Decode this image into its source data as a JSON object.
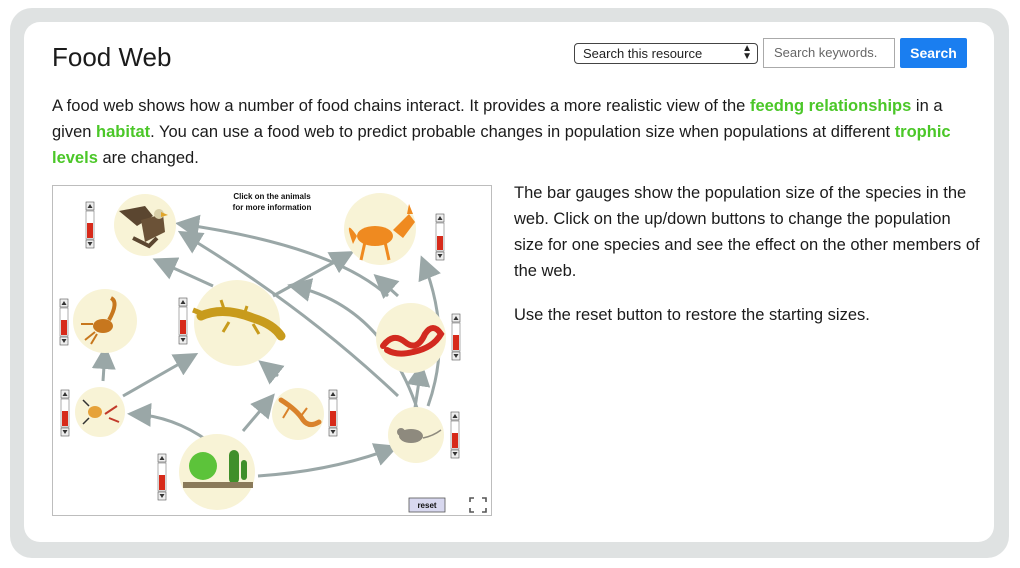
{
  "page": {
    "title": "Food Web",
    "search": {
      "select_value": "Search this resource",
      "placeholder": "Search keywords.",
      "button_label": "Search"
    },
    "intro": {
      "t1": "A food web shows how a number of food chains interact. It provides a more realistic view of the ",
      "link1": "feedng relationships",
      "t2": " in a given ",
      "link2": "habitat",
      "t3": ". You can use a food web to predict probable changes in population size when populations at different ",
      "link3": "trophic levels",
      "t4": " are changed."
    },
    "description": {
      "p1": "The bar gauges show the population size of the species in the web. Click on the up/down buttons to change the population size for one species and see the effect on the other members of the web.",
      "p2": "Use the reset button to restore the starting sizes."
    },
    "simulation": {
      "instruction_line1": "Click on the animals",
      "instruction_line2": "for more information",
      "reset_label": "reset",
      "colors": {
        "node_fill": "#f8f3d6",
        "arrow": "#9aa7a7",
        "gauge_high": "#d72a1a",
        "gauge_low": "#f0c53c"
      },
      "species": [
        {
          "name": "eagle",
          "population_level": 0.6
        },
        {
          "name": "fox",
          "population_level": 0.5
        },
        {
          "name": "scorpion",
          "population_level": 0.6
        },
        {
          "name": "lizard",
          "population_level": 0.5
        },
        {
          "name": "snake",
          "population_level": 0.6
        },
        {
          "name": "insect",
          "population_level": 0.6
        },
        {
          "name": "small-lizard",
          "population_level": 0.6
        },
        {
          "name": "mouse",
          "population_level": 0.6
        },
        {
          "name": "cactus-plants",
          "population_level": 0.6
        }
      ]
    }
  }
}
